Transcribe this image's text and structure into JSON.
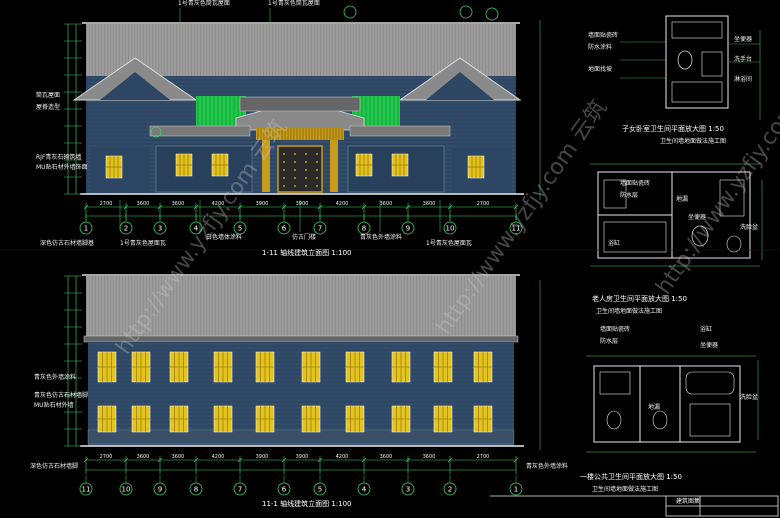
{
  "drawing": {
    "colors": {
      "background": "#000000",
      "roof": "#9a9a9a",
      "wall": "#2e4866",
      "wall_stone": "#3f5468",
      "window": "#e3c31e",
      "green": "#23d84a",
      "dim": "#3bd66b",
      "text": "#f2f2f2",
      "gold": "#e0b01d",
      "bath_line": "#e8e8e8"
    },
    "elev1": {
      "title": "1-11 轴线建筑立面图 1:100",
      "notes_top": [
        "1号青灰色筒瓦屋面",
        "1号青灰色筒瓦屋面"
      ],
      "notes_left": [
        "筒瓦屋面",
        "屋脊造型",
        "RJF青灰石砌筑墙",
        "MU贴石材外墙饰面"
      ],
      "notes_bottom": [
        "深色仿古石材墙脚基",
        "1号青灰色屋面瓦",
        "白色墙体涂料",
        "仿古门楼",
        "青灰色外墙涂料",
        "1号青灰色屋面瓦"
      ],
      "axis_labels": [
        "1",
        "2",
        "3",
        "4",
        "5",
        "6",
        "7",
        "8",
        "9",
        "10",
        "11"
      ],
      "dims": [
        "2700",
        "3600",
        "3600",
        "4200",
        "3900",
        "3900",
        "4200",
        "3600",
        "3600",
        "2700"
      ]
    },
    "elev2": {
      "title": "11-1 轴线建筑立面图 1:100",
      "notes_left": [
        "青灰色外墙涂料",
        "青灰色仿古石材墙脚",
        "MU贴石材外墙"
      ],
      "notes_bottom": [
        "深色仿古石材墙脚",
        "青灰色外墙涂料"
      ],
      "axis_labels": [
        "11",
        "10",
        "9",
        "8",
        "7",
        "6",
        "5",
        "4",
        "3",
        "2",
        "1"
      ],
      "dims": [
        "2700",
        "3600",
        "3600",
        "4200",
        "3900",
        "3900",
        "4200",
        "3600",
        "3600",
        "2700"
      ]
    },
    "bath1": {
      "title": "子女卧室卫生间平面放大图 1:50",
      "sub": "卫生间墙地面做法施工图",
      "notes": [
        "墙面贴瓷砖",
        "防水涂料",
        "地面找坡",
        "坐便器",
        "洗手台",
        "淋浴间"
      ]
    },
    "bath2": {
      "title": "老人房卫生间平面放大图 1:50",
      "sub": "卫生间墙地面做法施工图",
      "notes": [
        "墙面贴瓷砖",
        "防水层",
        "地漏",
        "洗脸盆",
        "坐便器",
        "浴缸"
      ]
    },
    "bath3": {
      "title": "一楼公共卫生间平面放大图 1:50",
      "sub": "卫生间墙地面做法施工图",
      "notes": [
        "墙面贴瓷砖",
        "防水层",
        "地漏",
        "浴缸",
        "坐便器",
        "洗脸盆"
      ]
    },
    "title_block": {
      "label": "建筑图集"
    },
    "watermark": "http://www.yzfjy.com 云筑"
  }
}
